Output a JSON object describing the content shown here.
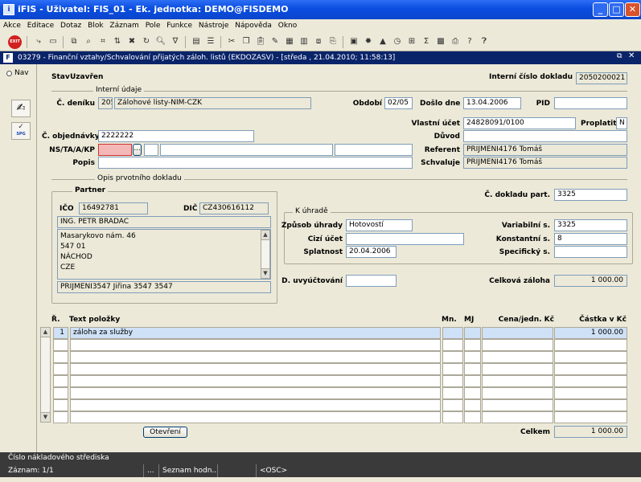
{
  "window": {
    "title": "iFIS - Uživatel: FIS_01 - Ek. jednotka: DEMO@FISDEMO",
    "app_icon": "ifis-app-icon"
  },
  "menu": [
    "Akce",
    "Editace",
    "Dotaz",
    "Blok",
    "Záznam",
    "Pole",
    "Funkce",
    "Nástroje",
    "Nápověda",
    "Okno"
  ],
  "toolbar": {
    "exit_label": "EXIT"
  },
  "subwindow": {
    "title": "03279 - Finanční vztahy/Schvalování přijatých záloh. listů (EKDOZASV) - [středa , 21.04.2010; 11:58:13]"
  },
  "nav": {
    "label": "Nav",
    "spg_label": "SPG"
  },
  "form": {
    "stav_label": "Stav",
    "stav_value": "Uzavřen",
    "interni_cislo_label": "Interní číslo dokladu",
    "interni_cislo_value": "2050200021",
    "interni_udaje_label": "Interní údaje",
    "cdeniku_label": "Č. deníku",
    "cdeniku_value": "205",
    "cdeniku_name": "Zálohové listy-NIM-CZK",
    "obdobi_label": "Období",
    "obdobi_value": "02/05",
    "doslo_label": "Došlo dne",
    "doslo_value": "13.04.2006",
    "pid_label": "PID",
    "pid_value": "",
    "vlastni_ucet_label": "Vlastní účet",
    "vlastni_ucet_value": "24828091/0100",
    "proplatit_label": "Proplatit",
    "proplatit_value": "N",
    "objednavky_label": "Č. objednávky",
    "objednavky_value": "2222222",
    "duvod_label": "Důvod",
    "duvod_value": "",
    "ns_label": "NS/TA/A/KP",
    "ns_value": "",
    "ns_lov": "...",
    "referent_label": "Referent",
    "referent_value": "PRIJMENI4176 Tomáš",
    "popis_label": "Popis",
    "popis_value": "",
    "schvaluje_label": "Schvaluje",
    "schvaluje_value": "PRIJMENI4176 Tomáš",
    "opis_label": "Opis prvotního dokladu",
    "partner_label": "Partner",
    "ico_label": "IČO",
    "ico_value": "16492781",
    "dic_label": "DIČ",
    "dic_value": "CZ430616112",
    "partner_name": "ING. PETR BRADAC",
    "address": [
      "Masarykovo nám. 46",
      "547 01",
      "NÁCHOD",
      "CZE"
    ],
    "contact": "PRIJMENI3547 Jiřina 3547 3547",
    "cdokladu_part_label": "Č. dokladu part.",
    "cdokladu_part_value": "3325",
    "k_uhrade_label": "K úhradě",
    "zpusob_label": "Způsob úhrady",
    "zpusob_value": "Hotovostí",
    "cizi_ucet_label": "Cizí účet",
    "cizi_ucet_value": "",
    "splatnost_label": "Splatnost",
    "splatnost_value": "20.04.2006",
    "variabilni_label": "Variabilní s.",
    "variabilni_value": "3325",
    "konstantni_label": "Konstantní s.",
    "konstantni_value": "8",
    "specificky_label": "Specifický s.",
    "specificky_value": "",
    "duct_label": "D. uvyúčtování",
    "duct_value": "",
    "celkova_zaloha_label": "Celková záloha",
    "celkova_zaloha_value": "1 000.00"
  },
  "grid": {
    "headers": {
      "r": "Ř.",
      "text": "Text položky",
      "mn": "Mn.",
      "mj": "MJ",
      "cena": "Cena/jedn. Kč",
      "castka": "Částka v Kč"
    },
    "rows": [
      {
        "r": "1",
        "text": "záloha za služby",
        "mn": "",
        "mj": "",
        "cena": "",
        "castka": "1 000.00"
      },
      {
        "r": "",
        "text": "",
        "mn": "",
        "mj": "",
        "cena": "",
        "castka": ""
      },
      {
        "r": "",
        "text": "",
        "mn": "",
        "mj": "",
        "cena": "",
        "castka": ""
      },
      {
        "r": "",
        "text": "",
        "mn": "",
        "mj": "",
        "cena": "",
        "castka": ""
      },
      {
        "r": "",
        "text": "",
        "mn": "",
        "mj": "",
        "cena": "",
        "castka": ""
      },
      {
        "r": "",
        "text": "",
        "mn": "",
        "mj": "",
        "cena": "",
        "castka": ""
      },
      {
        "r": "",
        "text": "",
        "mn": "",
        "mj": "",
        "cena": "",
        "castka": ""
      },
      {
        "r": "",
        "text": "",
        "mn": "",
        "mj": "",
        "cena": "",
        "castka": ""
      }
    ]
  },
  "otevreni_label": "Otevření",
  "celkem_label": "Celkem",
  "celkem_value": "1 000.00",
  "status": {
    "hint": "Číslo nákladového střediska",
    "record": "Záznam: 1/1",
    "seg2": "...",
    "seg3": "Seznam hodn...",
    "seg4": "<OSC>"
  }
}
